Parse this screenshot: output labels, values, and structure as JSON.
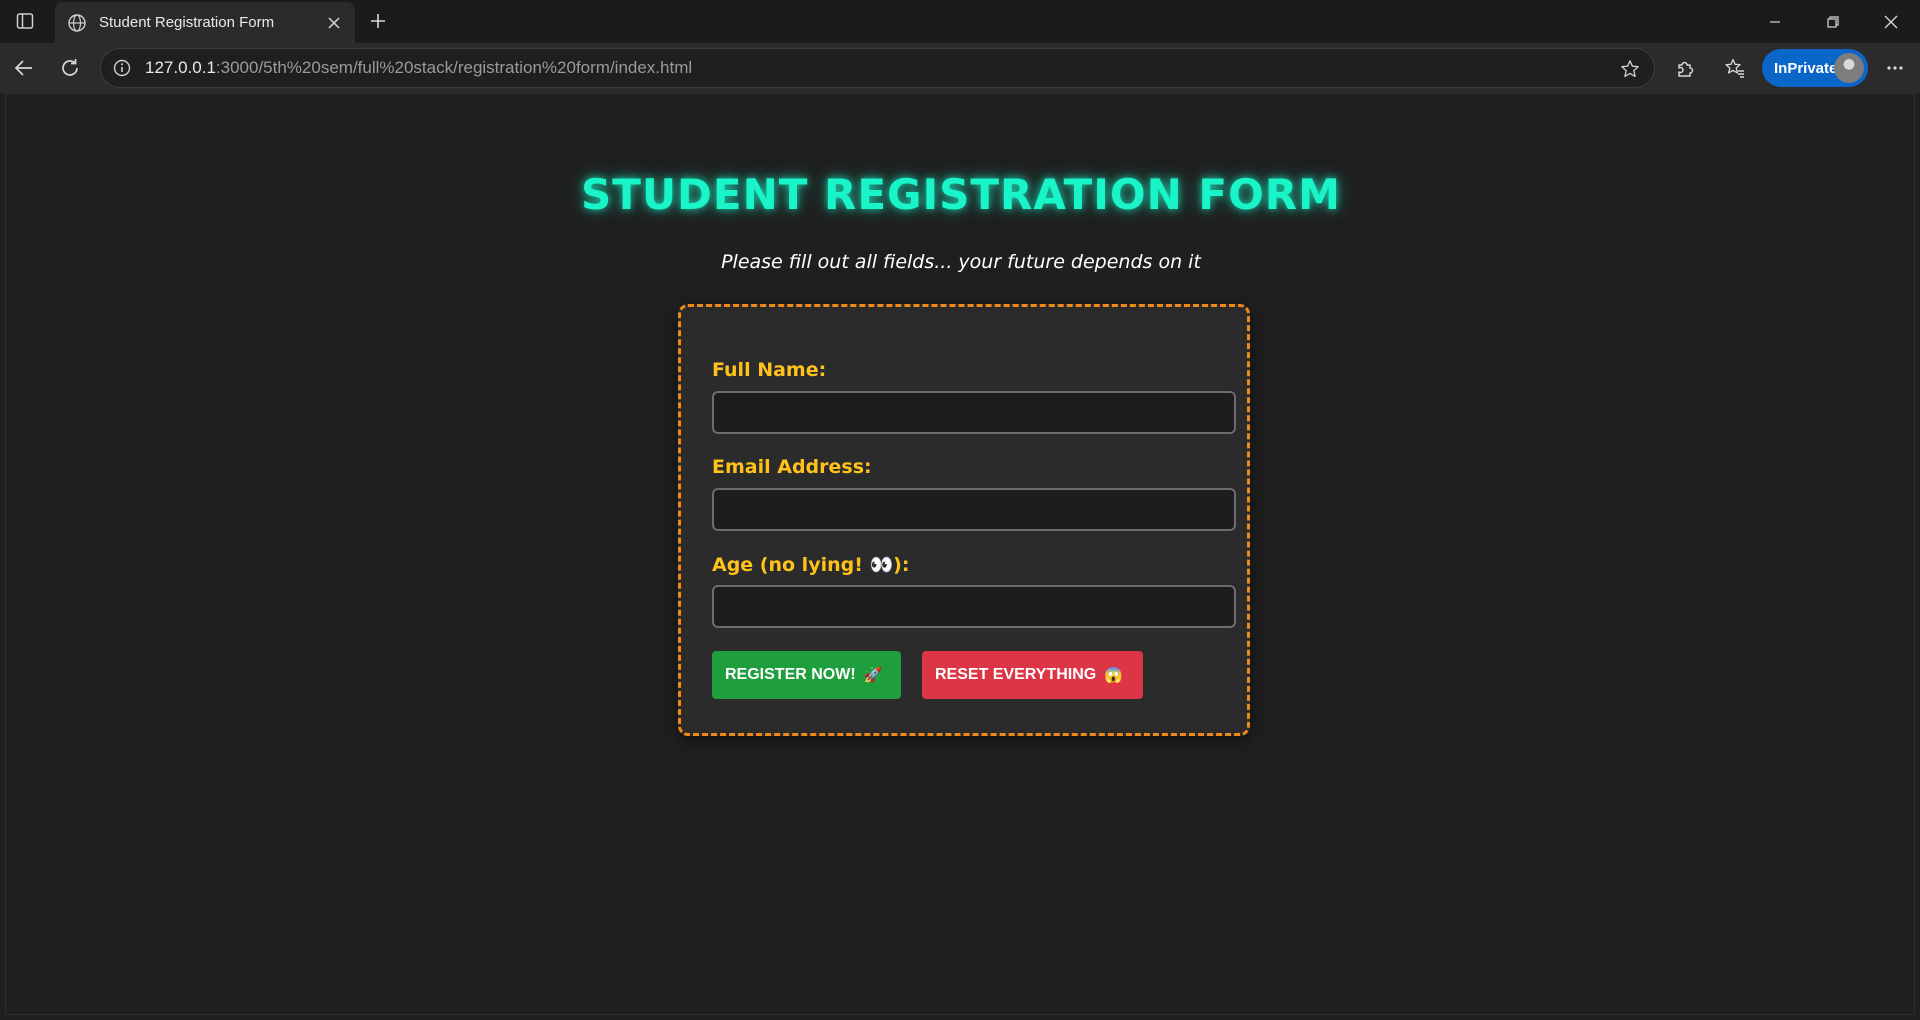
{
  "browser": {
    "tab_title": "Student Registration Form",
    "url_host": "127.0.0.1",
    "url_rest": ":3000/5th%20sem/full%20stack/registration%20form/index.html",
    "inprivate_label": "InPrivate",
    "icons": {
      "tab_actions": "tab-actions-icon",
      "favicon": "globe-icon",
      "close_tab": "close-icon",
      "new_tab": "plus-icon",
      "back": "back-arrow-icon",
      "refresh": "refresh-icon",
      "site_info": "info-icon",
      "favorite": "star-icon",
      "extensions": "puzzle-icon",
      "favorites": "favorites-icon",
      "more": "more-icon",
      "minimize": "minimize-icon",
      "restore": "restore-icon",
      "close_window": "close-icon"
    }
  },
  "page": {
    "title": "STUDENT REGISTRATION FORM",
    "subtitle": "Please fill out all fields... your future depends on it"
  },
  "form": {
    "full_name": {
      "label": "Full Name:",
      "value": "",
      "placeholder": ""
    },
    "email": {
      "label": "Email Address:",
      "value": "",
      "placeholder": ""
    },
    "age": {
      "label": "Age (no lying! 👀):",
      "value": "",
      "placeholder": ""
    },
    "register_label": "REGISTER NOW!",
    "register_emoji": "🚀",
    "reset_label": "RESET EVERYTHING",
    "reset_emoji": "😱"
  },
  "colors": {
    "title": "#19f5c9",
    "label": "#ffc21a",
    "card_border": "#f08a16",
    "register": "#1f9e3d",
    "reset": "#dc3545",
    "inprivate": "#0a66c9"
  }
}
